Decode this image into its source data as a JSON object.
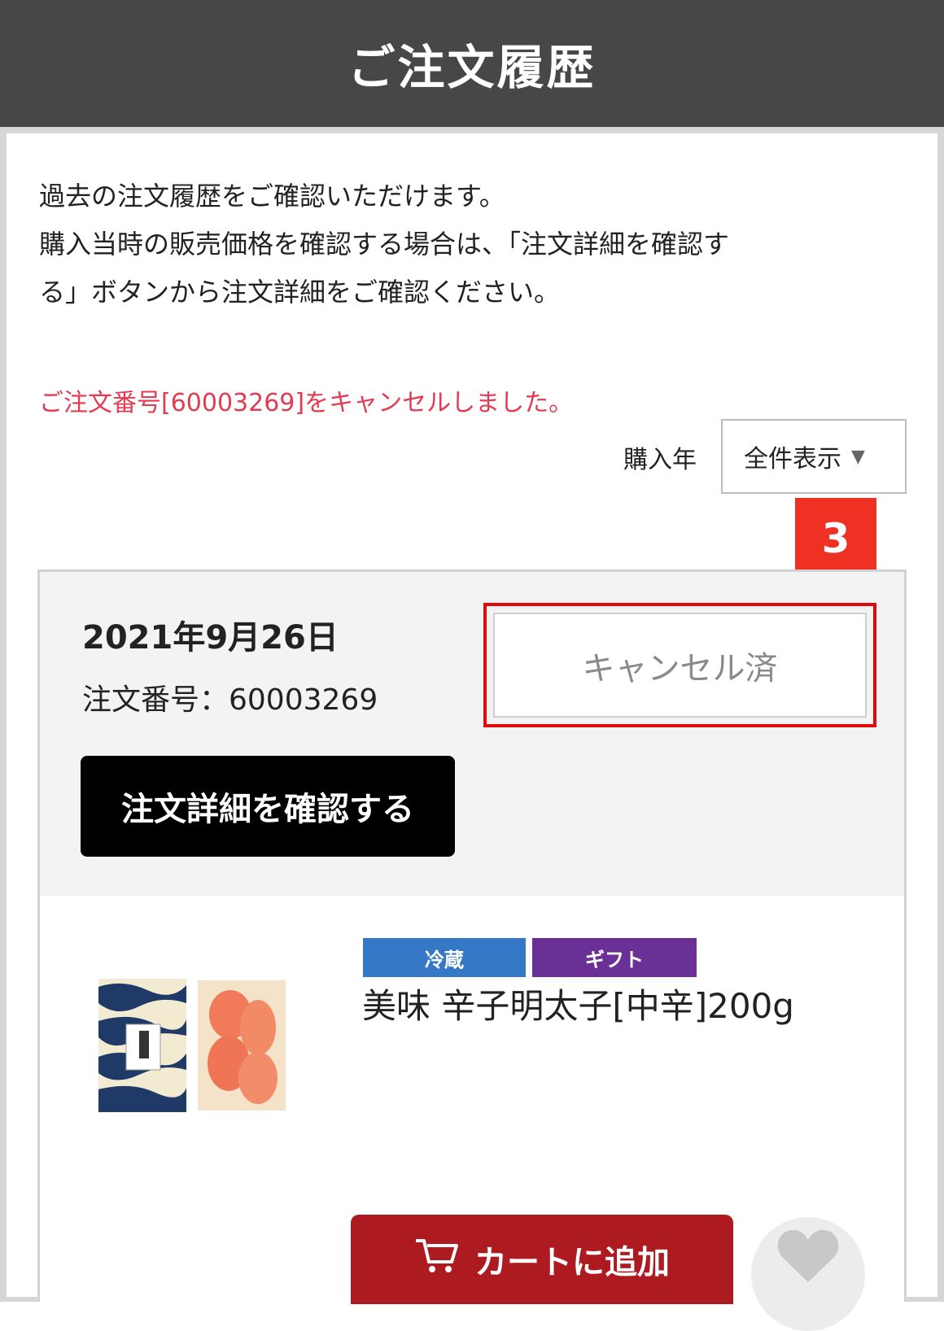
{
  "header": {
    "title": "ご注文履歴"
  },
  "intro": {
    "line1": "過去の注文履歴をご確認いただけます。",
    "line2": "購入当時の販売価格を確認する場合は、「注文詳細を確認す",
    "line3": "る」ボタンから注文詳細をご確認ください。"
  },
  "notice": {
    "cancel_message": "ご注文番号[60003269]をキャンセルしました。"
  },
  "filter": {
    "label": "購入年",
    "selected": "全件表示",
    "caret_icon": "triangle-down-icon"
  },
  "annotation": {
    "step": "3",
    "color": "#ef3124"
  },
  "order": {
    "date": "2021年9月26日",
    "number_text": "注文番号：60003269",
    "cancel_status": "キャンセル済",
    "detail_button": "注文詳細を確認する"
  },
  "product": {
    "tags": [
      {
        "label": "冷蔵",
        "color": "#3478c6"
      },
      {
        "label": "ギフト",
        "color": "#6b3095"
      }
    ],
    "name": "美味 辛子明太子[中辛]200g",
    "image_icon": "mentaiko-product-image"
  },
  "actions": {
    "cart_label": "カートに追加",
    "cart_icon": "cart-icon",
    "favorite_icon": "heart-icon",
    "cart_color": "#ad1a20"
  }
}
